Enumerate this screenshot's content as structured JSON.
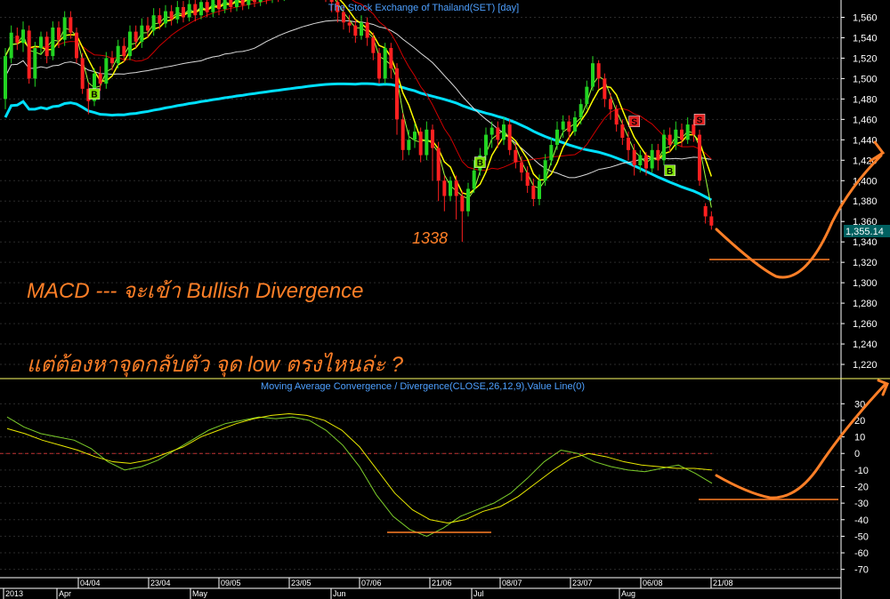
{
  "colors": {
    "background": "#000000",
    "grid": "#2b2b2b",
    "up_candle": "#22d422",
    "down_candle": "#ff2020",
    "ma_fast": "#ffff00",
    "ma_mid": "#d00000",
    "ma_slow": "#dcdcdc",
    "ma_long": "#00e0ff",
    "price_line": "#a0ff40",
    "macd_line": "#7ccd2a",
    "signal_line": "#e8e800",
    "annotation": "#ff7f27",
    "title": "#4ea0ff",
    "buy_marker": "#7ee000",
    "sell_marker": "#e02020",
    "price_tag": "#006060"
  },
  "chart_data": [
    {
      "type": "candlestick",
      "title": "The Stock Exchange of Thailand(SET) [day]",
      "ylim": [
        1200,
        1570
      ],
      "yticks": [
        1220,
        1240,
        1260,
        1280,
        1300,
        1320,
        1340,
        1360,
        1380,
        1400,
        1420,
        1440,
        1460,
        1480,
        1500,
        1520,
        1540,
        1560
      ],
      "ytick_labels": [
        "1,220",
        "1,240",
        "1,260",
        "1,280",
        "1,300",
        "1,320",
        "1,340",
        "1,360",
        "1,380",
        "1,400",
        "1,420",
        "1,440",
        "1,460",
        "1,480",
        "1,500",
        "1,520",
        "1,540",
        "1,560"
      ],
      "last_price_label": "1,355.14",
      "low_label": "1338",
      "candles": [
        [
          1480,
          1522,
          1470,
          1530
        ],
        [
          1520,
          1545,
          1515,
          1552
        ],
        [
          1542,
          1535,
          1528,
          1550
        ],
        [
          1535,
          1548,
          1526,
          1556
        ],
        [
          1547,
          1500,
          1495,
          1552
        ],
        [
          1500,
          1530,
          1492,
          1536
        ],
        [
          1530,
          1541,
          1524,
          1546
        ],
        [
          1541,
          1522,
          1515,
          1546
        ],
        [
          1522,
          1550,
          1518,
          1556
        ],
        [
          1550,
          1538,
          1530,
          1556
        ],
        [
          1538,
          1560,
          1532,
          1566
        ],
        [
          1560,
          1545,
          1539,
          1566
        ],
        [
          1545,
          1520,
          1515,
          1550
        ],
        [
          1520,
          1490,
          1485,
          1525
        ],
        [
          1490,
          1478,
          1465,
          1496
        ],
        [
          1478,
          1505,
          1473,
          1510
        ],
        [
          1505,
          1495,
          1488,
          1512
        ],
        [
          1495,
          1520,
          1490,
          1526
        ],
        [
          1520,
          1515,
          1508,
          1527
        ],
        [
          1515,
          1532,
          1510,
          1538
        ],
        [
          1532,
          1522,
          1516,
          1540
        ],
        [
          1522,
          1546,
          1518,
          1552
        ],
        [
          1546,
          1536,
          1530,
          1552
        ],
        [
          1536,
          1552,
          1530,
          1559
        ],
        [
          1552,
          1547,
          1540,
          1560
        ],
        [
          1547,
          1562,
          1542,
          1569
        ],
        [
          1562,
          1554,
          1548,
          1569
        ],
        [
          1554,
          1566,
          1550,
          1572
        ],
        [
          1566,
          1558,
          1552,
          1572
        ],
        [
          1558,
          1570,
          1554,
          1576
        ],
        [
          1570,
          1560,
          1555,
          1576
        ],
        [
          1560,
          1573,
          1556,
          1580
        ],
        [
          1573,
          1562,
          1556,
          1580
        ],
        [
          1562,
          1575,
          1558,
          1582
        ],
        [
          1575,
          1565,
          1560,
          1582
        ],
        [
          1565,
          1578,
          1560,
          1585
        ],
        [
          1578,
          1568,
          1562,
          1585
        ],
        [
          1568,
          1580,
          1564,
          1588
        ],
        [
          1580,
          1570,
          1565,
          1588
        ],
        [
          1570,
          1582,
          1566,
          1590
        ],
        [
          1582,
          1572,
          1567,
          1590
        ],
        [
          1572,
          1585,
          1568,
          1592
        ],
        [
          1585,
          1575,
          1570,
          1592
        ],
        [
          1575,
          1586,
          1571,
          1594
        ],
        [
          1586,
          1578,
          1573,
          1594
        ],
        [
          1578,
          1588,
          1574,
          1596
        ],
        [
          1588,
          1580,
          1575,
          1596
        ],
        [
          1580,
          1590,
          1576,
          1598
        ],
        [
          1590,
          1582,
          1577,
          1598
        ],
        [
          1582,
          1592,
          1578,
          1600
        ],
        [
          1592,
          1585,
          1580,
          1600
        ],
        [
          1585,
          1594,
          1581,
          1602
        ],
        [
          1594,
          1586,
          1581,
          1602
        ],
        [
          1586,
          1590,
          1580,
          1598
        ],
        [
          1590,
          1582,
          1575,
          1596
        ],
        [
          1582,
          1575,
          1565,
          1590
        ],
        [
          1575,
          1565,
          1555,
          1582
        ],
        [
          1565,
          1555,
          1548,
          1572
        ],
        [
          1555,
          1552,
          1545,
          1562
        ],
        [
          1552,
          1542,
          1535,
          1558
        ],
        [
          1542,
          1555,
          1538,
          1562
        ],
        [
          1555,
          1540,
          1532,
          1560
        ],
        [
          1540,
          1525,
          1518,
          1545
        ],
        [
          1525,
          1500,
          1495,
          1530
        ],
        [
          1500,
          1530,
          1495,
          1535
        ],
        [
          1530,
          1510,
          1500,
          1535
        ],
        [
          1510,
          1460,
          1445,
          1515
        ],
        [
          1460,
          1430,
          1420,
          1466
        ],
        [
          1430,
          1440,
          1425,
          1450
        ],
        [
          1440,
          1448,
          1432,
          1456
        ],
        [
          1448,
          1425,
          1418,
          1452
        ],
        [
          1425,
          1450,
          1420,
          1458
        ],
        [
          1450,
          1432,
          1400,
          1455
        ],
        [
          1432,
          1400,
          1380,
          1438
        ],
        [
          1400,
          1385,
          1370,
          1405
        ],
        [
          1385,
          1400,
          1380,
          1404
        ],
        [
          1400,
          1385,
          1362,
          1405
        ],
        [
          1385,
          1370,
          1340,
          1390
        ],
        [
          1370,
          1392,
          1365,
          1398
        ],
        [
          1392,
          1410,
          1388,
          1420
        ],
        [
          1410,
          1425,
          1405,
          1432
        ],
        [
          1425,
          1445,
          1420,
          1452
        ],
        [
          1445,
          1452,
          1432,
          1458
        ],
        [
          1452,
          1440,
          1432,
          1458
        ],
        [
          1440,
          1455,
          1435,
          1462
        ],
        [
          1455,
          1430,
          1425,
          1460
        ],
        [
          1430,
          1418,
          1412,
          1436
        ],
        [
          1418,
          1408,
          1400,
          1424
        ],
        [
          1408,
          1395,
          1388,
          1414
        ],
        [
          1395,
          1382,
          1375,
          1402
        ],
        [
          1382,
          1400,
          1376,
          1406
        ],
        [
          1400,
          1420,
          1395,
          1426
        ],
        [
          1420,
          1435,
          1415,
          1442
        ],
        [
          1435,
          1450,
          1430,
          1458
        ],
        [
          1450,
          1458,
          1442,
          1464
        ],
        [
          1458,
          1448,
          1440,
          1464
        ],
        [
          1448,
          1462,
          1444,
          1468
        ],
        [
          1462,
          1475,
          1455,
          1480
        ],
        [
          1475,
          1492,
          1470,
          1498
        ],
        [
          1492,
          1515,
          1488,
          1522
        ],
        [
          1515,
          1500,
          1490,
          1518
        ],
        [
          1500,
          1480,
          1472,
          1505
        ],
        [
          1480,
          1470,
          1460,
          1486
        ],
        [
          1470,
          1455,
          1448,
          1474
        ],
        [
          1455,
          1442,
          1435,
          1460
        ],
        [
          1442,
          1430,
          1420,
          1448
        ],
        [
          1430,
          1415,
          1405,
          1436
        ],
        [
          1415,
          1425,
          1408,
          1430
        ],
        [
          1425,
          1412,
          1405,
          1428
        ],
        [
          1412,
          1430,
          1408,
          1436
        ],
        [
          1430,
          1420,
          1410,
          1436
        ],
        [
          1420,
          1445,
          1415,
          1450
        ],
        [
          1445,
          1435,
          1428,
          1452
        ],
        [
          1435,
          1450,
          1430,
          1458
        ],
        [
          1450,
          1440,
          1433,
          1456
        ],
        [
          1440,
          1455,
          1436,
          1462
        ],
        [
          1455,
          1445,
          1438,
          1460
        ],
        [
          1445,
          1400,
          1395,
          1450
        ],
        [
          1375,
          1365,
          1358,
          1378
        ],
        [
          1365,
          1356,
          1352,
          1370
        ]
      ],
      "markers": [
        {
          "label": "B",
          "type": "buy",
          "index": 15,
          "value": 1485
        },
        {
          "label": "B",
          "type": "buy",
          "index": 80,
          "value": 1418
        },
        {
          "label": "S",
          "type": "sell",
          "index": 106,
          "value": 1458
        },
        {
          "label": "B",
          "type": "buy",
          "index": 112,
          "value": 1410
        },
        {
          "label": "S",
          "type": "sell",
          "index": 117,
          "value": 1460
        }
      ]
    },
    {
      "type": "line",
      "title": "Moving Average Convergence / Divergence(CLOSE,26,12,9),Value Line(0)",
      "ylim": [
        -75,
        35
      ],
      "yticks": [
        30,
        20,
        10,
        0,
        -10,
        -20,
        -30,
        -40,
        -50,
        -60,
        -70
      ],
      "ytick_labels": [
        "30",
        "20",
        "10",
        "0",
        "-10",
        "-20",
        "-30",
        "-40",
        "-50",
        "-60",
        "-70"
      ],
      "zero_line": 0,
      "series": [
        {
          "values": [
            22,
            16,
            12,
            10,
            8,
            3,
            -5,
            -10,
            -8,
            -4,
            2,
            8,
            14,
            18,
            20,
            22,
            21,
            22,
            20,
            14,
            5,
            -8,
            -25,
            -38,
            -46,
            -50,
            -45,
            -38,
            -34,
            -30,
            -24,
            -15,
            -5,
            2,
            0,
            -5,
            -8,
            -10,
            -11,
            -9,
            -7,
            -12,
            -18
          ]
        },
        {
          "values": [
            15,
            12,
            8,
            5,
            2,
            -2,
            -5,
            -6,
            -4,
            0,
            4,
            10,
            14,
            18,
            21,
            23,
            24,
            23,
            20,
            14,
            4,
            -10,
            -24,
            -34,
            -40,
            -42,
            -40,
            -35,
            -32,
            -26,
            -18,
            -10,
            -3,
            0,
            -2,
            -5,
            -7,
            -8,
            -9,
            -9,
            -10
          ]
        }
      ]
    }
  ],
  "x_axis": {
    "top_labels": [
      "04/04",
      "23/04",
      "09/05",
      "23/05",
      "07/06",
      "21/06",
      "08/07",
      "23/07",
      "06/08",
      "21/08"
    ],
    "bottom_labels": [
      "2013",
      "Apr",
      "May",
      "Jun",
      "Jul",
      "Aug"
    ]
  },
  "annotations": {
    "line1": "MACD --- จะเข้า Bullish Divergence",
    "line2": "แต่ต้องหาจุดกลับตัว จุด low ตรงไหนล่ะ ?"
  }
}
